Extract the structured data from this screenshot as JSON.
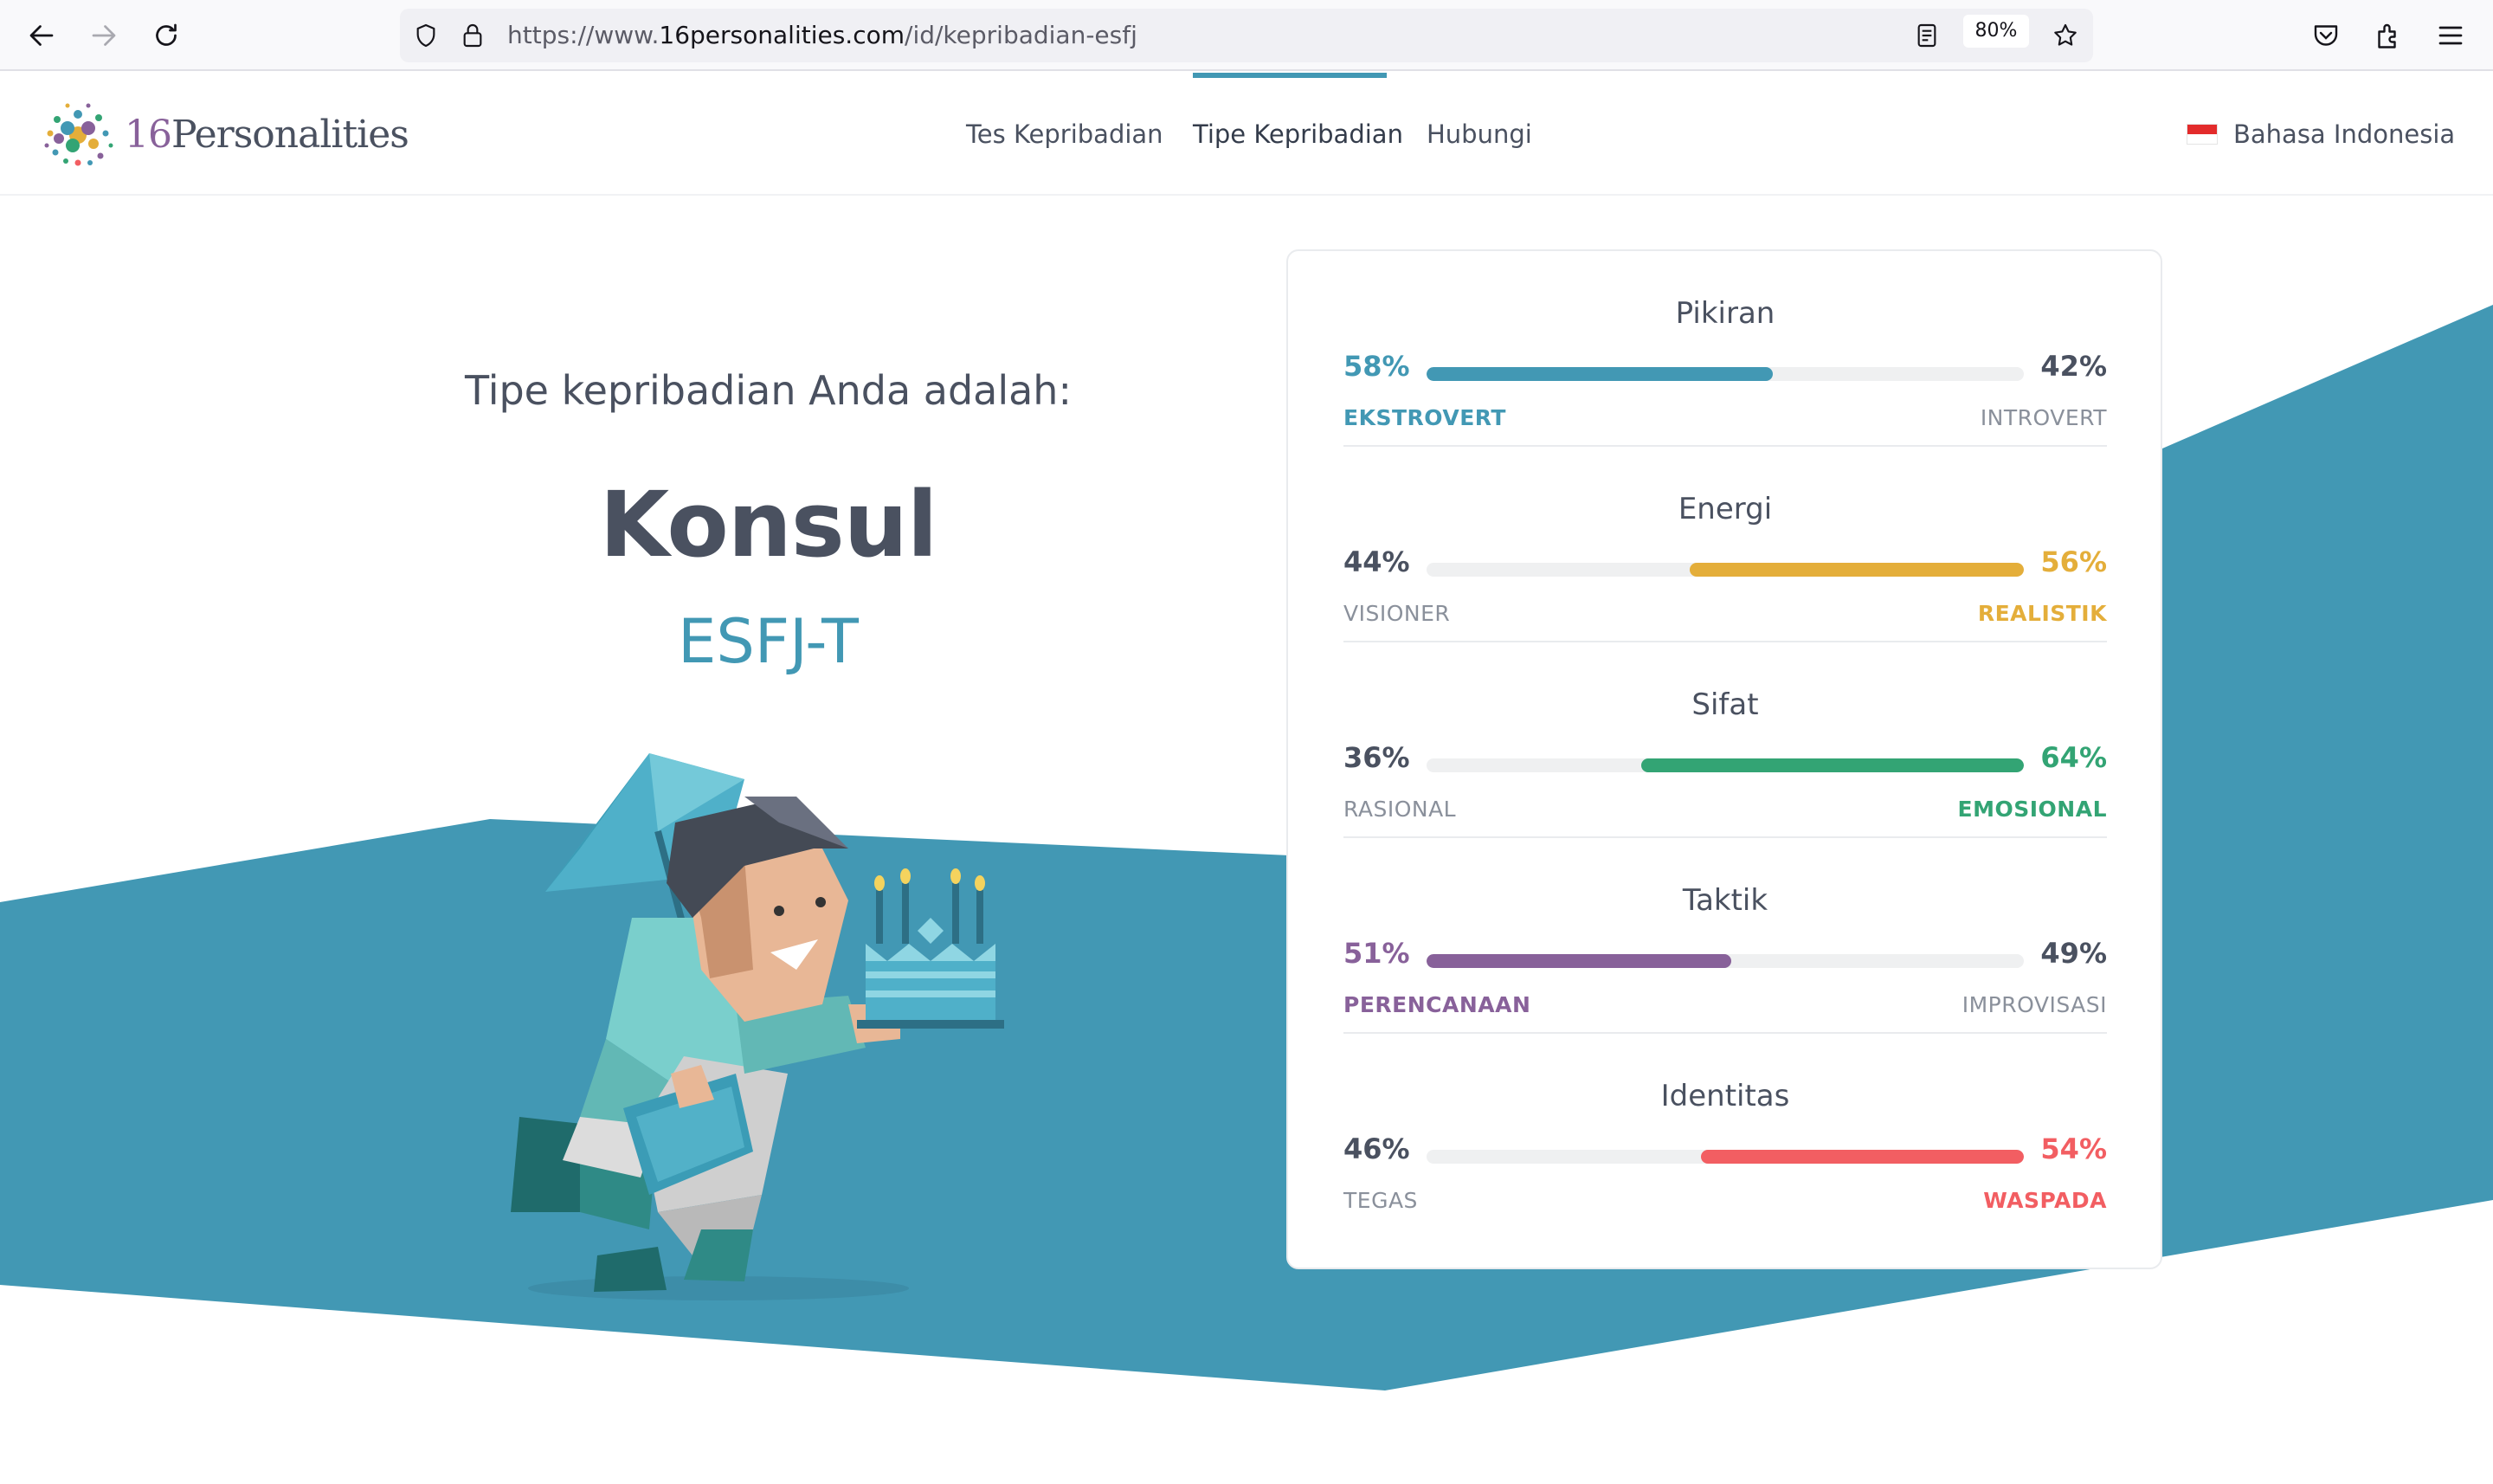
{
  "browser": {
    "url_prefix": "https://www.",
    "url_host": "16personalities.com",
    "url_path": "/id/kepribadian-esfj",
    "zoom": "80%"
  },
  "header": {
    "logo_number": "16",
    "logo_word": "Personalities",
    "nav": [
      {
        "label": "Tes Kepribadian",
        "active": false
      },
      {
        "label": "Tipe Kepribadian",
        "active": true
      },
      {
        "label": "Hubungi",
        "active": false
      }
    ],
    "language": "Bahasa Indonesia"
  },
  "result": {
    "label": "Tipe kepribadian Anda adalah:",
    "type_name": "Konsul",
    "type_code": "ESFJ-T"
  },
  "traits": [
    {
      "title": "Pikiran",
      "left_pct": "58%",
      "right_pct": "42%",
      "left_label": "EKSTROVERT",
      "right_label": "INTROVERT",
      "dominant": "left",
      "value": 58,
      "color": "#4298b4"
    },
    {
      "title": "Energi",
      "left_pct": "44%",
      "right_pct": "56%",
      "left_label": "VISIONER",
      "right_label": "REALISTIK",
      "dominant": "right",
      "value": 56,
      "color": "#e4ae3a"
    },
    {
      "title": "Sifat",
      "left_pct": "36%",
      "right_pct": "64%",
      "left_label": "RASIONAL",
      "right_label": "EMOSIONAL",
      "dominant": "right",
      "value": 64,
      "color": "#33a474"
    },
    {
      "title": "Taktik",
      "left_pct": "51%",
      "right_pct": "49%",
      "left_label": "PERENCANAAN",
      "right_label": "IMPROVISASI",
      "dominant": "left",
      "value": 51,
      "color": "#88619a"
    },
    {
      "title": "Identitas",
      "left_pct": "46%",
      "right_pct": "54%",
      "left_label": "TEGAS",
      "right_label": "WASPADA",
      "dominant": "right",
      "value": 54,
      "color": "#f25e62"
    }
  ],
  "colors": {
    "brand_teal": "#4298b4",
    "text_dark": "#4a5160"
  },
  "icons": [
    "back-arrow-icon",
    "forward-arrow-icon",
    "reload-icon",
    "shield-icon",
    "lock-icon",
    "reader-view-icon",
    "bookmark-star-icon",
    "pocket-icon",
    "extensions-icon",
    "menu-icon",
    "flag-icon",
    "logo-icon"
  ]
}
